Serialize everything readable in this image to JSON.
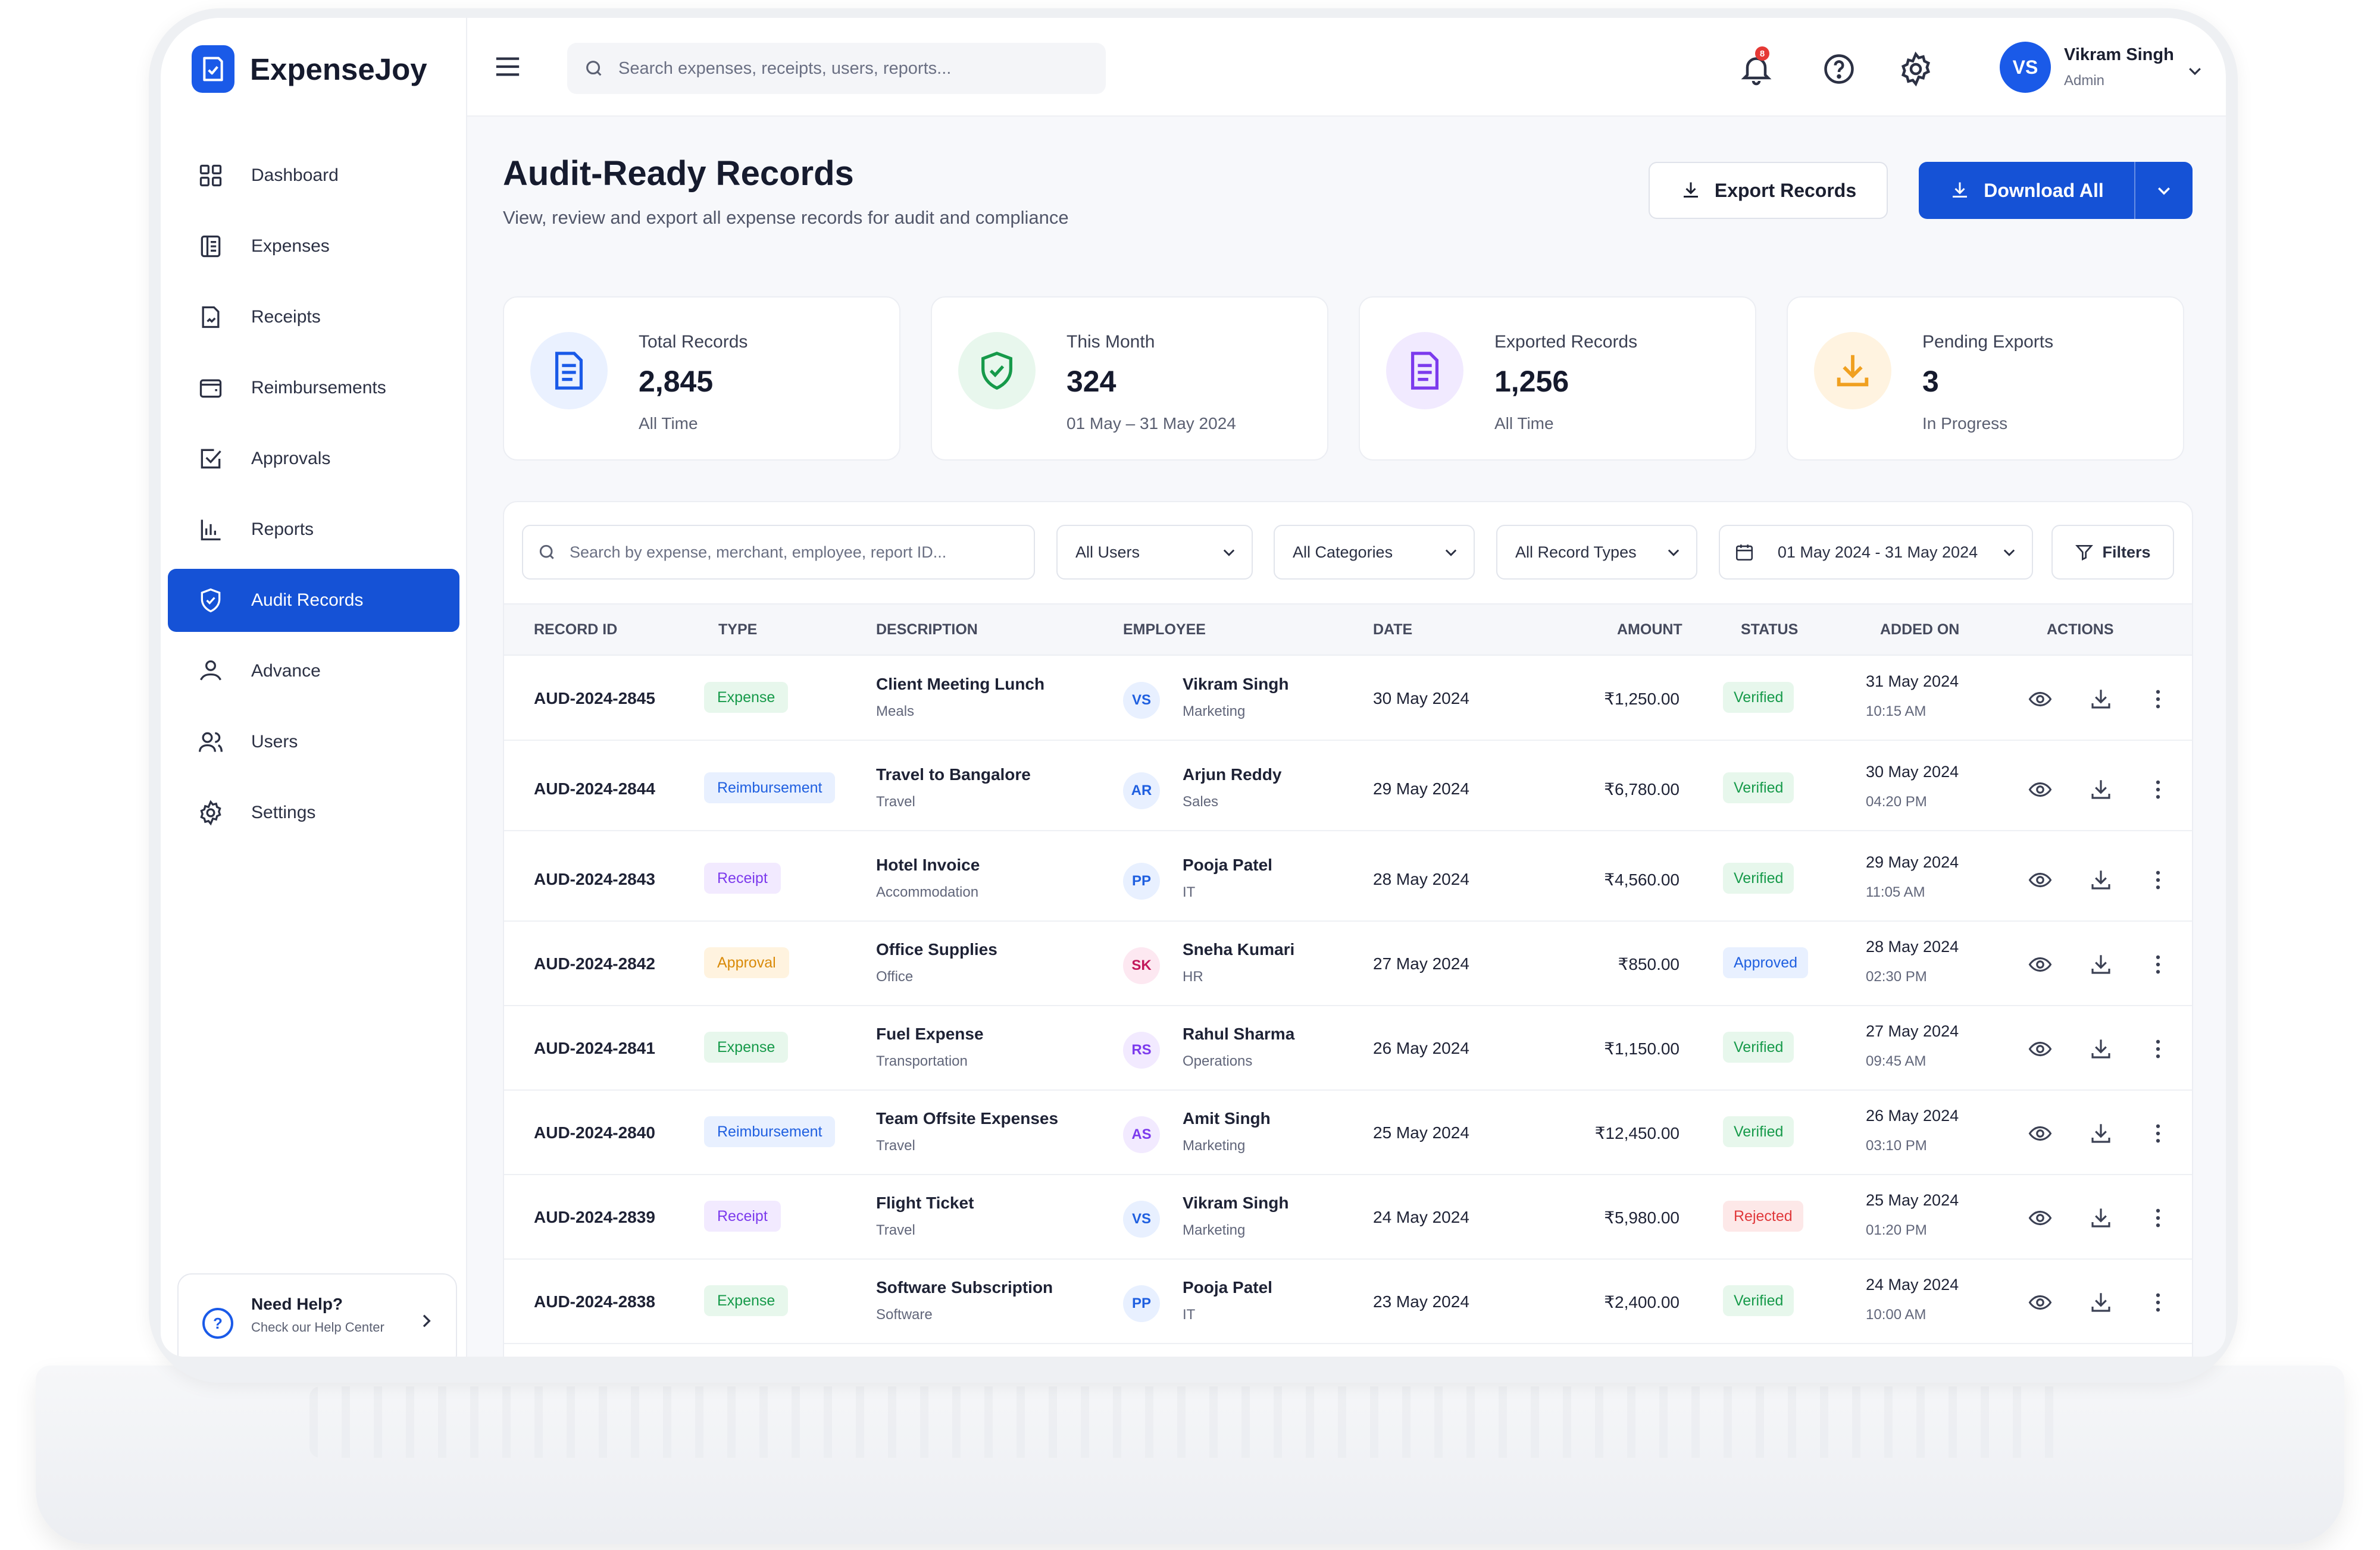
{
  "app": {
    "name": "ExpenseJoy"
  },
  "sidebar": {
    "items": [
      {
        "label": "Dashboard",
        "icon": "grid-icon"
      },
      {
        "label": "Expenses",
        "icon": "ledger-icon"
      },
      {
        "label": "Receipts",
        "icon": "receipt-icon"
      },
      {
        "label": "Reimbursements",
        "icon": "wallet-icon"
      },
      {
        "label": "Approvals",
        "icon": "check-square-icon"
      },
      {
        "label": "Reports",
        "icon": "bar-chart-icon"
      },
      {
        "label": "Audit Records",
        "icon": "shield-icon",
        "active": true
      },
      {
        "label": "Advance",
        "icon": "hand-coin-icon"
      },
      {
        "label": "Users",
        "icon": "users-icon"
      },
      {
        "label": "Settings",
        "icon": "gear-icon"
      }
    ],
    "help": {
      "title": "Need Help?",
      "subtitle": "Check our Help Center"
    }
  },
  "topbar": {
    "search_placeholder": "Search expenses, receipts, users, reports...",
    "notification_count": "8",
    "user": {
      "initials": "VS",
      "name": "Vikram Singh",
      "role": "Admin"
    }
  },
  "page": {
    "title": "Audit-Ready Records",
    "subtitle": "View, review and export all expense records for audit and compliance",
    "export_label": "Export Records",
    "download_label": "Download All"
  },
  "stats": [
    {
      "label": "Total Records",
      "value": "2,845",
      "sub": "All Time",
      "color": "#1a5ae8",
      "bg": "#eaf1ff"
    },
    {
      "label": "This Month",
      "value": "324",
      "sub": "01 May – 31 May 2024",
      "color": "#169a4a",
      "bg": "#e8f7ed"
    },
    {
      "label": "Exported Records",
      "value": "1,256",
      "sub": "All Time",
      "color": "#7c3aed",
      "bg": "#f1eaff"
    },
    {
      "label": "Pending Exports",
      "value": "3",
      "sub": "In Progress",
      "color": "#f0a020",
      "bg": "#fff3e0"
    }
  ],
  "filters": {
    "search_placeholder": "Search by expense, merchant, employee, report ID...",
    "users": "All Users",
    "categories": "All Categories",
    "record_types": "All Record Types",
    "date_range": "01 May 2024 - 31 May 2024",
    "filters_label": "Filters"
  },
  "table": {
    "headers": [
      "Record ID",
      "Type",
      "Description",
      "Employee",
      "Date",
      "Amount",
      "Status",
      "Added On",
      "Actions"
    ],
    "rows": [
      {
        "id": "AUD-2024-2845",
        "type": "Expense",
        "type_key": "expense",
        "desc": "Client Meeting Lunch",
        "desc_sub": "Meals",
        "initials": "VS",
        "emp": "Vikram Singh",
        "dept": "Marketing",
        "date": "30 May 2024",
        "amount": "₹1,250.00",
        "status": "Verified",
        "status_key": "verified",
        "added_date": "31 May 2024",
        "added_time": "10:15 AM"
      },
      {
        "id": "AUD-2024-2844",
        "type": "Reimbursement",
        "type_key": "reimbursement",
        "desc": "Travel to Bangalore",
        "desc_sub": "Travel",
        "initials": "AR",
        "emp": "Arjun Reddy",
        "dept": "Sales",
        "date": "29 May 2024",
        "amount": "₹6,780.00",
        "status": "Verified",
        "status_key": "verified",
        "added_date": "30 May 2024",
        "added_time": "04:20 PM"
      },
      {
        "id": "AUD-2024-2843",
        "type": "Receipt",
        "type_key": "receipt",
        "desc": "Hotel Invoice",
        "desc_sub": "Accommodation",
        "initials": "PP",
        "emp": "Pooja Patel",
        "dept": "IT",
        "date": "28 May 2024",
        "amount": "₹4,560.00",
        "status": "Verified",
        "status_key": "verified",
        "added_date": "29 May 2024",
        "added_time": "11:05 AM"
      },
      {
        "id": "AUD-2024-2842",
        "type": "Approval",
        "type_key": "approval",
        "desc": "Office Supplies",
        "desc_sub": "Office",
        "initials": "SK",
        "emp": "Sneha Kumari",
        "dept": "HR",
        "date": "27 May 2024",
        "amount": "₹850.00",
        "status": "Approved",
        "status_key": "approved",
        "added_date": "28 May 2024",
        "added_time": "02:30 PM"
      },
      {
        "id": "AUD-2024-2841",
        "type": "Expense",
        "type_key": "expense",
        "desc": "Fuel Expense",
        "desc_sub": "Transportation",
        "initials": "RS",
        "emp": "Rahul Sharma",
        "dept": "Operations",
        "date": "26 May 2024",
        "amount": "₹1,150.00",
        "status": "Verified",
        "status_key": "verified",
        "added_date": "27 May 2024",
        "added_time": "09:45 AM"
      },
      {
        "id": "AUD-2024-2840",
        "type": "Reimbursement",
        "type_key": "reimbursement",
        "desc": "Team Offsite Expenses",
        "desc_sub": "Travel",
        "initials": "AS",
        "emp": "Amit Singh",
        "dept": "Marketing",
        "date": "25 May 2024",
        "amount": "₹12,450.00",
        "status": "Verified",
        "status_key": "verified",
        "added_date": "26 May 2024",
        "added_time": "03:10 PM"
      },
      {
        "id": "AUD-2024-2839",
        "type": "Receipt",
        "type_key": "receipt",
        "desc": "Flight Ticket",
        "desc_sub": "Travel",
        "initials": "VS",
        "emp": "Vikram Singh",
        "dept": "Marketing",
        "date": "24 May 2024",
        "amount": "₹5,980.00",
        "status": "Rejected",
        "status_key": "rejected",
        "added_date": "25 May 2024",
        "added_time": "01:20 PM"
      },
      {
        "id": "AUD-2024-2838",
        "type": "Expense",
        "type_key": "expense",
        "desc": "Software Subscription",
        "desc_sub": "Software",
        "initials": "PP",
        "emp": "Pooja Patel",
        "dept": "IT",
        "date": "23 May 2024",
        "amount": "₹2,400.00",
        "status": "Verified",
        "status_key": "verified",
        "added_date": "24 May 2024",
        "added_time": "10:00 AM"
      }
    ]
  },
  "avatar_colors": {
    "VS": [
      "#e8f0ff",
      "#1f5fe0"
    ],
    "AR": [
      "#e8f0ff",
      "#1f5fe0"
    ],
    "PP": [
      "#e8f0ff",
      "#1f5fe0"
    ],
    "SK": [
      "#fde8f1",
      "#c2185b"
    ],
    "RS": [
      "#f2eaff",
      "#7c3aed"
    ],
    "AS": [
      "#f2eaff",
      "#7c3aed"
    ]
  }
}
